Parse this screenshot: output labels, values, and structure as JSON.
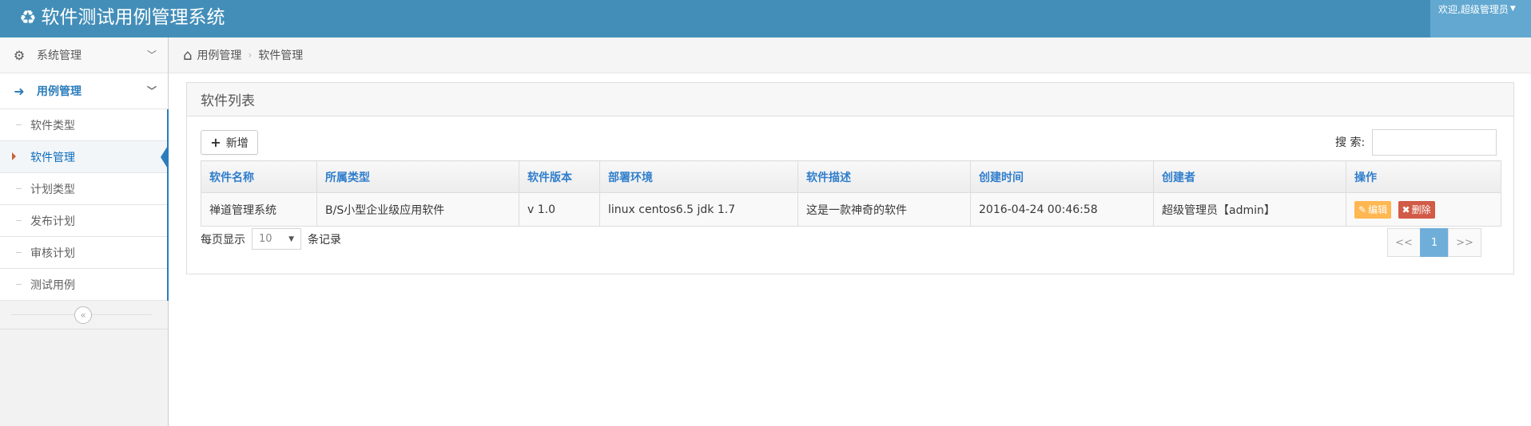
{
  "header": {
    "title": "软件测试用例管理系统",
    "user_menu": "欢迎,超级管理员"
  },
  "sidebar": {
    "groups": [
      {
        "label": "系统管理",
        "icon": "gears-icon",
        "open": false
      },
      {
        "label": "用例管理",
        "icon": "sign-in-icon",
        "open": true
      }
    ],
    "items": [
      {
        "label": "软件类型"
      },
      {
        "label": "软件管理",
        "active": true
      },
      {
        "label": "计划类型"
      },
      {
        "label": "发布计划"
      },
      {
        "label": "审核计划"
      },
      {
        "label": "测试用例"
      }
    ],
    "collapse_icon": "double-chevron-left-icon"
  },
  "breadcrumb": {
    "items": [
      "用例管理",
      "软件管理"
    ]
  },
  "widget": {
    "title": "软件列表",
    "add_button": "新增",
    "search_label": "搜 索:",
    "search_value": ""
  },
  "table": {
    "columns": [
      "软件名称",
      "所属类型",
      "软件版本",
      "部署环境",
      "软件描述",
      "创建时间",
      "创建者",
      "操作"
    ],
    "rows": [
      {
        "name": "禅道管理系统",
        "type": "B/S小型企业级应用软件",
        "version": "v 1.0",
        "env": "linux centos6.5 jdk 1.7",
        "desc": "这是一款神奇的软件",
        "created": "2016-04-24 00:46:58",
        "creator": "超级管理员【admin】",
        "edit": "编辑",
        "delete": "删除"
      }
    ]
  },
  "length_menu": {
    "prefix": "每页显示",
    "value": "10",
    "suffix": "条记录"
  },
  "pagination": {
    "prev": "<<",
    "current": "1",
    "next": ">>"
  },
  "colors": {
    "navbar": "#438eb9",
    "accent": "#2b7dbc",
    "edit_button": "#ffb752",
    "delete_button": "#d15b47",
    "pager_active": "#6faed9"
  }
}
